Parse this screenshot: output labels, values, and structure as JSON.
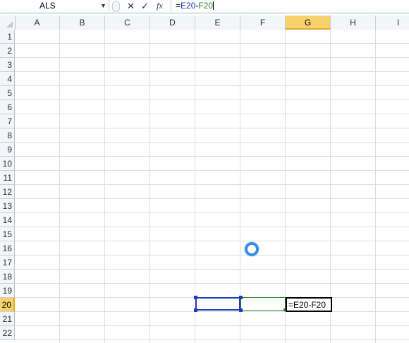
{
  "formula_bar": {
    "name_box": "ALS",
    "formula": "=E20-F20",
    "formula_ref1": "E20",
    "formula_op": "-",
    "formula_ref2": "F20",
    "fx_label": "fx"
  },
  "columns": [
    "A",
    "B",
    "C",
    "D",
    "E",
    "F",
    "G",
    "H",
    "I"
  ],
  "active_column": "G",
  "rows": [
    "1",
    "2",
    "3",
    "4",
    "5",
    "6",
    "7",
    "8",
    "9",
    "10",
    "11",
    "12",
    "13",
    "14",
    "15",
    "16",
    "17",
    "18",
    "19",
    "20",
    "21",
    "22"
  ],
  "active_row": "20",
  "active_cell": {
    "ref": "G20",
    "content": "=E20-F20"
  },
  "colors": {
    "ref_e": "#1f3dbb",
    "ref_f": "#2e8b2e",
    "active_header": "#f7d26c",
    "busy_cursor": "#3a8ee6"
  }
}
